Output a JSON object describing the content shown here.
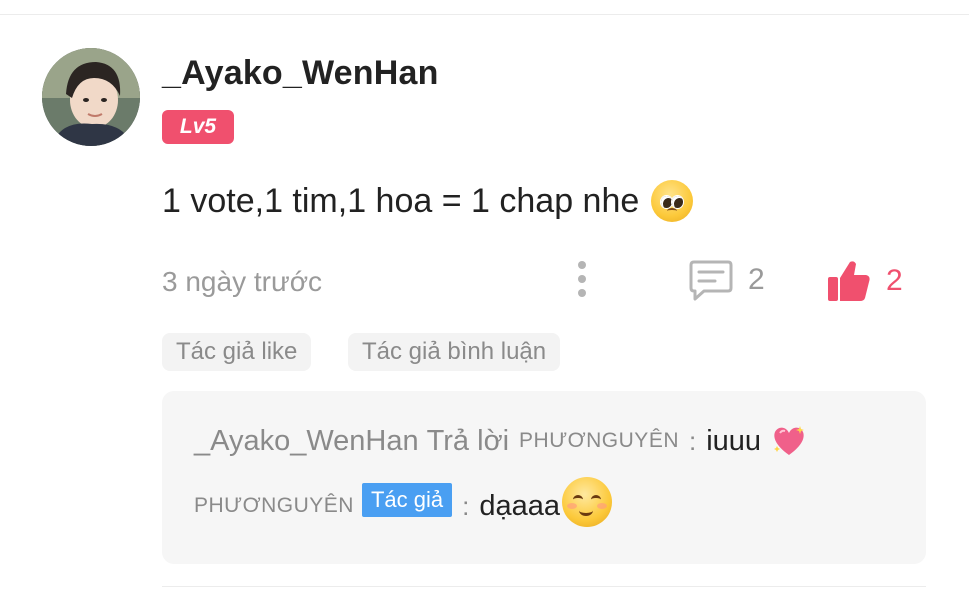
{
  "comment": {
    "username": "_Ayako_WenHan",
    "level": "Lv5",
    "text": "1 vote,1 tim,1 hoa = 1 chap nhe",
    "text_emoji_icon": "pleading-face-emoji",
    "time": "3 ngày trước",
    "reply_count": "2",
    "like_count": "2",
    "tags": [
      "Tác giả like",
      "Tác giả bình luận"
    ]
  },
  "replies": [
    {
      "user": "_Ayako_WenHan",
      "verb": "Trả lời",
      "target": "PHƯƠNGUYÊN",
      "colon": ":",
      "text": "iuuu",
      "emoji_icon": "sparkling-heart-emoji"
    },
    {
      "user": "PHƯƠNGUYÊN",
      "badge": "Tác giả",
      "colon": ":",
      "text": "dạaaa",
      "emoji_icon": "smiling-face-emoji"
    }
  ],
  "colors": {
    "accent_pink": "#f0506e",
    "author_badge_blue": "#4a9ff2",
    "muted_text": "#9a9a9a"
  }
}
